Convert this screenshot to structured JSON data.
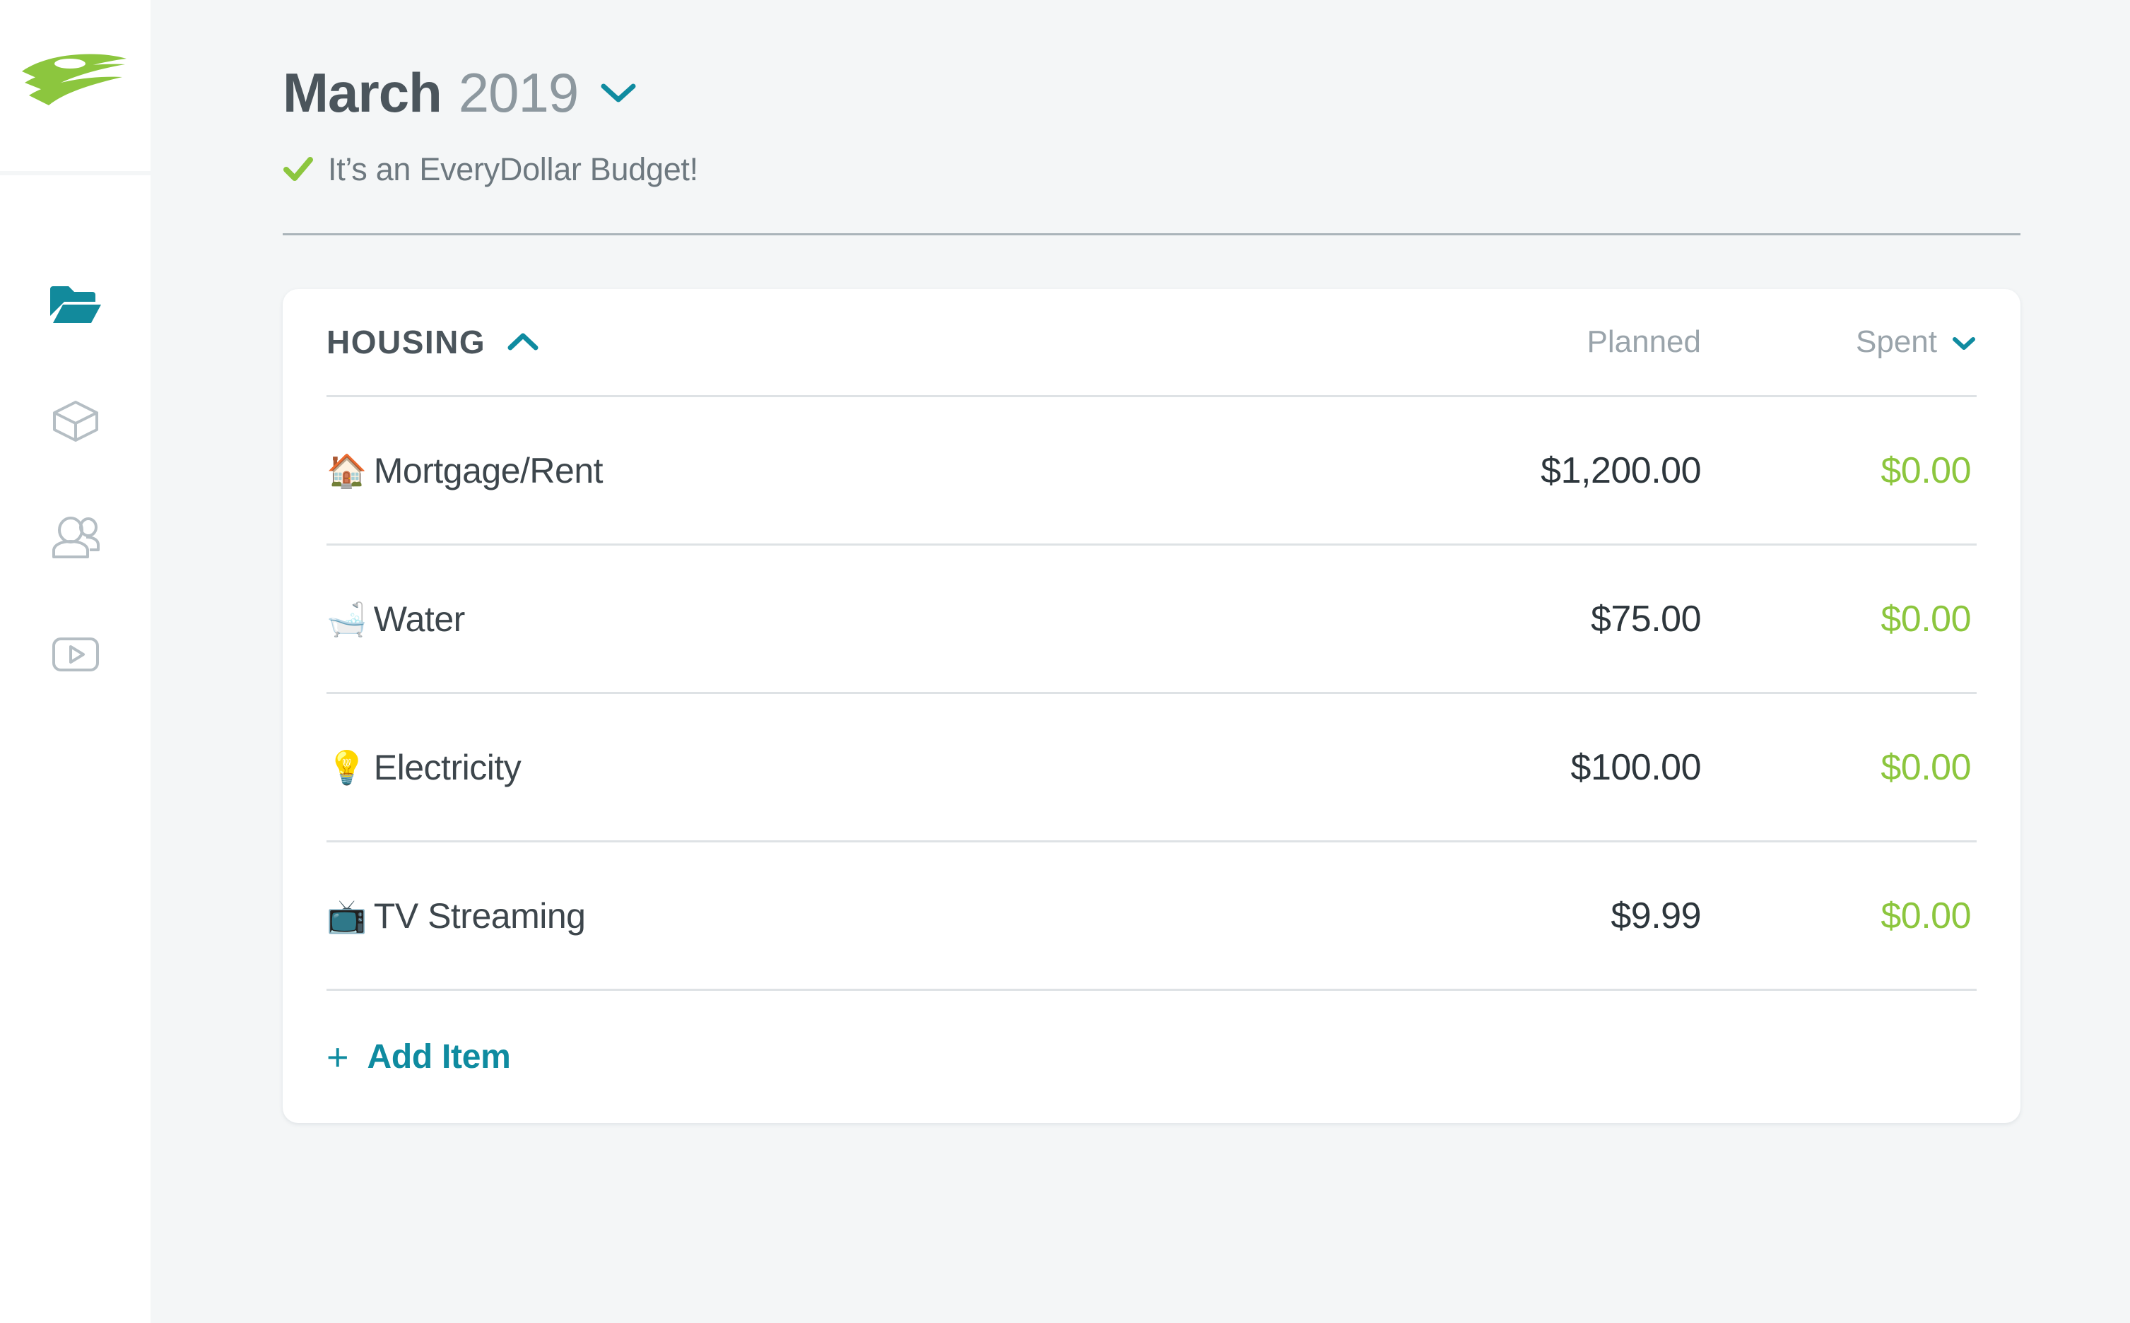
{
  "app": {
    "logo_name": "everydollar-logo",
    "brand_green": "#8cc63e",
    "accent_teal": "#0f8ba0"
  },
  "sidebar": {
    "items": [
      {
        "icon": "folder-icon",
        "name": "budget",
        "active": true
      },
      {
        "icon": "box-icon",
        "name": "fund",
        "active": false
      },
      {
        "icon": "people-icon",
        "name": "community",
        "active": false
      },
      {
        "icon": "video-icon",
        "name": "videos",
        "active": false
      }
    ]
  },
  "header": {
    "month": "March",
    "year": "2019",
    "month_chevron_icon": "chevron-down-icon",
    "status_check_icon": "check-icon",
    "status_text": "It’s an EveryDollar Budget!"
  },
  "budget_group": {
    "title": "HOUSING",
    "collapse_icon": "chevron-up-icon",
    "columns": {
      "planned": "Planned",
      "spent": "Spent",
      "spent_chevron_icon": "chevron-down-icon"
    },
    "items": [
      {
        "emoji": "🏠",
        "emoji_name": "house-emoji",
        "label": "Mortgage/Rent",
        "planned": "$1,200.00",
        "spent": "$0.00"
      },
      {
        "emoji": "🛁",
        "emoji_name": "bathtub-emoji",
        "label": "Water",
        "planned": "$75.00",
        "spent": "$0.00"
      },
      {
        "emoji": "💡",
        "emoji_name": "lightbulb-emoji",
        "label": "Electricity",
        "planned": "$100.00",
        "spent": "$0.00"
      },
      {
        "emoji": "📺",
        "emoji_name": "television-emoji",
        "label": "TV Streaming",
        "planned": "$9.99",
        "spent": "$0.00"
      }
    ],
    "add_item": {
      "plus": "+",
      "label": "Add Item"
    }
  }
}
